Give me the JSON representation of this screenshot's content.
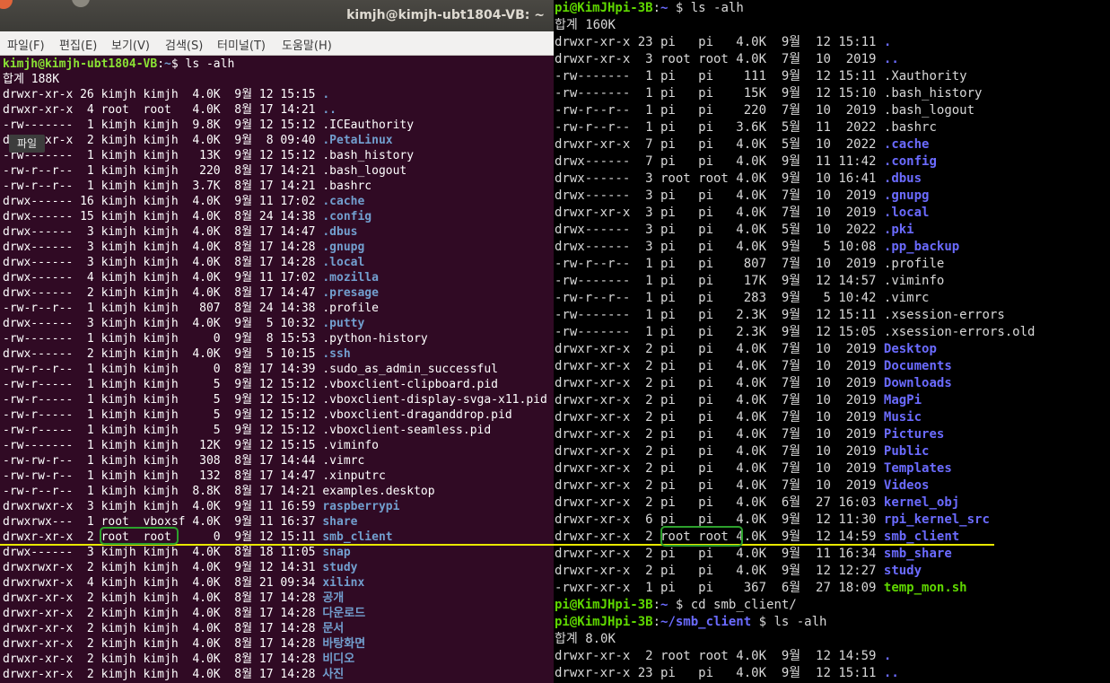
{
  "left_window": {
    "title": "kimjh@kimjh-ubt1804-VB: ~",
    "menu": [
      "파일(F)",
      "편집(E)",
      "보기(V)",
      "검색(S)",
      "터미널(T)",
      "도움말(H)"
    ],
    "tooltip": "파일",
    "prompt": {
      "user_host": "kimjh@kimjh-ubt1804-VB",
      "sep": ":",
      "path": "~",
      "symbol": "$ ",
      "command": "ls -alh"
    },
    "total": "합계 188K",
    "lines": [
      {
        "meta": "drwxr-xr-x 26 kimjh kimjh  4.0K  9월 12 15:15 ",
        "name": ".",
        "type": "dir"
      },
      {
        "meta": "drwxr-xr-x  4 root  root   4.0K  8월 17 14:21 ",
        "name": "..",
        "type": "dir"
      },
      {
        "meta": "-rw-------  1 kimjh kimjh  9.8K  9월 12 15:12 ",
        "name": ".ICEauthority",
        "type": "file"
      },
      {
        "meta": "drwxr-xr-x  2 kimjh kimjh  4.0K  9월  8 09:40 ",
        "name": ".PetaLinux",
        "type": "dir"
      },
      {
        "meta": "-rw-------  1 kimjh kimjh   13K  9월 12 15:12 ",
        "name": ".bash_history",
        "type": "file"
      },
      {
        "meta": "-rw-r--r--  1 kimjh kimjh   220  8월 17 14:21 ",
        "name": ".bash_logout",
        "type": "file"
      },
      {
        "meta": "-rw-r--r--  1 kimjh kimjh  3.7K  8월 17 14:21 ",
        "name": ".bashrc",
        "type": "file"
      },
      {
        "meta": "drwx------ 16 kimjh kimjh  4.0K  9월 11 17:02 ",
        "name": ".cache",
        "type": "dir"
      },
      {
        "meta": "drwx------ 15 kimjh kimjh  4.0K  8월 24 14:38 ",
        "name": ".config",
        "type": "dir"
      },
      {
        "meta": "drwx------  3 kimjh kimjh  4.0K  8월 17 14:47 ",
        "name": ".dbus",
        "type": "dir"
      },
      {
        "meta": "drwx------  3 kimjh kimjh  4.0K  8월 17 14:28 ",
        "name": ".gnupg",
        "type": "dir"
      },
      {
        "meta": "drwx------  3 kimjh kimjh  4.0K  8월 17 14:28 ",
        "name": ".local",
        "type": "dir"
      },
      {
        "meta": "drwx------  4 kimjh kimjh  4.0K  9월 11 17:02 ",
        "name": ".mozilla",
        "type": "dir"
      },
      {
        "meta": "drwx------  2 kimjh kimjh  4.0K  8월 17 14:47 ",
        "name": ".presage",
        "type": "dir"
      },
      {
        "meta": "-rw-r--r--  1 kimjh kimjh   807  8월 24 14:38 ",
        "name": ".profile",
        "type": "file"
      },
      {
        "meta": "drwx------  3 kimjh kimjh  4.0K  9월  5 10:32 ",
        "name": ".putty",
        "type": "dir"
      },
      {
        "meta": "-rw-------  1 kimjh kimjh     0  9월  8 15:53 ",
        "name": ".python-history",
        "type": "file"
      },
      {
        "meta": "drwx------  2 kimjh kimjh  4.0K  9월  5 10:15 ",
        "name": ".ssh",
        "type": "dir"
      },
      {
        "meta": "-rw-r--r--  1 kimjh kimjh     0  8월 17 14:39 ",
        "name": ".sudo_as_admin_successful",
        "type": "file"
      },
      {
        "meta": "-rw-r-----  1 kimjh kimjh     5  9월 12 15:12 ",
        "name": ".vboxclient-clipboard.pid",
        "type": "file"
      },
      {
        "meta": "-rw-r-----  1 kimjh kimjh     5  9월 12 15:12 ",
        "name": ".vboxclient-display-svga-x11.pid",
        "type": "file"
      },
      {
        "meta": "-rw-r-----  1 kimjh kimjh     5  9월 12 15:12 ",
        "name": ".vboxclient-draganddrop.pid",
        "type": "file"
      },
      {
        "meta": "-rw-r-----  1 kimjh kimjh     5  9월 12 15:12 ",
        "name": ".vboxclient-seamless.pid",
        "type": "file"
      },
      {
        "meta": "-rw-------  1 kimjh kimjh   12K  9월 12 15:15 ",
        "name": ".viminfo",
        "type": "file"
      },
      {
        "meta": "-rw-rw-r--  1 kimjh kimjh   308  8월 17 14:44 ",
        "name": ".vimrc",
        "type": "file"
      },
      {
        "meta": "-rw-rw-r--  1 kimjh kimjh   132  8월 17 14:47 ",
        "name": ".xinputrc",
        "type": "file"
      },
      {
        "meta": "-rw-r--r--  1 kimjh kimjh  8.8K  8월 17 14:21 ",
        "name": "examples.desktop",
        "type": "file"
      },
      {
        "meta": "drwxrwxr-x  3 kimjh kimjh  4.0K  9월 11 16:59 ",
        "name": "raspberrypi",
        "type": "dir"
      },
      {
        "meta": "drwxrwx---  1 root  vboxsf 4.0K  9월 11 16:37 ",
        "name": "share",
        "type": "dir"
      },
      {
        "meta": "drwxr-xr-x  2 root  root      0  9월 12 15:11 ",
        "name": "smb_client",
        "type": "dir"
      },
      {
        "meta": "drwx------  3 kimjh kimjh  4.0K  8월 18 11:05 ",
        "name": "snap",
        "type": "dir"
      },
      {
        "meta": "drwxrwxr-x  2 kimjh kimjh  4.0K  9월 12 14:31 ",
        "name": "study",
        "type": "dir"
      },
      {
        "meta": "drwxrwxr-x  4 kimjh kimjh  4.0K  8월 21 09:34 ",
        "name": "xilinx",
        "type": "dir"
      },
      {
        "meta": "drwxr-xr-x  2 kimjh kimjh  4.0K  8월 17 14:28 ",
        "name": "공개",
        "type": "dir"
      },
      {
        "meta": "drwxr-xr-x  2 kimjh kimjh  4.0K  8월 17 14:28 ",
        "name": "다운로드",
        "type": "dir"
      },
      {
        "meta": "drwxr-xr-x  2 kimjh kimjh  4.0K  8월 17 14:28 ",
        "name": "문서",
        "type": "dir"
      },
      {
        "meta": "drwxr-xr-x  2 kimjh kimjh  4.0K  8월 17 14:28 ",
        "name": "바탕화면",
        "type": "dir"
      },
      {
        "meta": "drwxr-xr-x  2 kimjh kimjh  4.0K  8월 17 14:28 ",
        "name": "비디오",
        "type": "dir"
      },
      {
        "meta": "drwxr-xr-x  2 kimjh kimjh  4.0K  8월 17 14:28 ",
        "name": "사진",
        "type": "dir"
      }
    ]
  },
  "right_window": {
    "prompt1": {
      "user_host": "pi@KimJHpi-3B",
      "sep": ":",
      "path": "~",
      "symbol": " $ ",
      "command": "ls -alh"
    },
    "total1": "합계 160K",
    "lines1": [
      {
        "meta": "drwxr-xr-x 23 pi   pi   4.0K  9월  12 15:11 ",
        "name": ".",
        "type": "dir"
      },
      {
        "meta": "drwxr-xr-x  3 root root 4.0K  7월  10  2019 ",
        "name": "..",
        "type": "dir"
      },
      {
        "meta": "-rw-------  1 pi   pi    111  9월  12 15:11 ",
        "name": ".Xauthority",
        "type": "file"
      },
      {
        "meta": "-rw-------  1 pi   pi    15K  9월  12 15:10 ",
        "name": ".bash_history",
        "type": "file"
      },
      {
        "meta": "-rw-r--r--  1 pi   pi    220  7월  10  2019 ",
        "name": ".bash_logout",
        "type": "file"
      },
      {
        "meta": "-rw-r--r--  1 pi   pi   3.6K  5월  11  2022 ",
        "name": ".bashrc",
        "type": "file"
      },
      {
        "meta": "drwxr-xr-x  7 pi   pi   4.0K  5월  10  2022 ",
        "name": ".cache",
        "type": "dir"
      },
      {
        "meta": "drwx------  7 pi   pi   4.0K  9월  11 11:42 ",
        "name": ".config",
        "type": "dir"
      },
      {
        "meta": "drwx------  3 root root 4.0K  9월  10 16:41 ",
        "name": ".dbus",
        "type": "dir"
      },
      {
        "meta": "drwx------  3 pi   pi   4.0K  7월  10  2019 ",
        "name": ".gnupg",
        "type": "dir"
      },
      {
        "meta": "drwxr-xr-x  3 pi   pi   4.0K  7월  10  2019 ",
        "name": ".local",
        "type": "dir"
      },
      {
        "meta": "drwx------  3 pi   pi   4.0K  5월  10  2022 ",
        "name": ".pki",
        "type": "dir"
      },
      {
        "meta": "drwx------  3 pi   pi   4.0K  9월   5 10:08 ",
        "name": ".pp_backup",
        "type": "dir"
      },
      {
        "meta": "-rw-r--r--  1 pi   pi    807  7월  10  2019 ",
        "name": ".profile",
        "type": "file"
      },
      {
        "meta": "-rw-------  1 pi   pi    17K  9월  12 14:57 ",
        "name": ".viminfo",
        "type": "file"
      },
      {
        "meta": "-rw-r--r--  1 pi   pi    283  9월   5 10:42 ",
        "name": ".vimrc",
        "type": "file"
      },
      {
        "meta": "-rw-------  1 pi   pi   2.3K  9월  12 15:11 ",
        "name": ".xsession-errors",
        "type": "file"
      },
      {
        "meta": "-rw-------  1 pi   pi   2.3K  9월  12 15:05 ",
        "name": ".xsession-errors.old",
        "type": "file"
      },
      {
        "meta": "drwxr-xr-x  2 pi   pi   4.0K  7월  10  2019 ",
        "name": "Desktop",
        "type": "dir"
      },
      {
        "meta": "drwxr-xr-x  2 pi   pi   4.0K  7월  10  2019 ",
        "name": "Documents",
        "type": "dir"
      },
      {
        "meta": "drwxr-xr-x  2 pi   pi   4.0K  7월  10  2019 ",
        "name": "Downloads",
        "type": "dir"
      },
      {
        "meta": "drwxr-xr-x  2 pi   pi   4.0K  7월  10  2019 ",
        "name": "MagPi",
        "type": "dir"
      },
      {
        "meta": "drwxr-xr-x  2 pi   pi   4.0K  7월  10  2019 ",
        "name": "Music",
        "type": "dir"
      },
      {
        "meta": "drwxr-xr-x  2 pi   pi   4.0K  7월  10  2019 ",
        "name": "Pictures",
        "type": "dir"
      },
      {
        "meta": "drwxr-xr-x  2 pi   pi   4.0K  7월  10  2019 ",
        "name": "Public",
        "type": "dir"
      },
      {
        "meta": "drwxr-xr-x  2 pi   pi   4.0K  7월  10  2019 ",
        "name": "Templates",
        "type": "dir"
      },
      {
        "meta": "drwxr-xr-x  2 pi   pi   4.0K  7월  10  2019 ",
        "name": "Videos",
        "type": "dir"
      },
      {
        "meta": "drwxr-xr-x  2 pi   pi   4.0K  6월  27 16:03 ",
        "name": "kernel_obj",
        "type": "dir"
      },
      {
        "meta": "drwxr-xr-x  6 pi   pi   4.0K  9월  12 11:30 ",
        "name": "rpi_kernel_src",
        "type": "dir"
      },
      {
        "meta": "drwxr-xr-x  2 root root 4.0K  9월  12 14:59 ",
        "name": "smb_client",
        "type": "dir"
      },
      {
        "meta": "drwxr-xr-x  2 pi   pi   4.0K  9월  11 16:34 ",
        "name": "smb_share",
        "type": "dir"
      },
      {
        "meta": "drwxr-xr-x  2 pi   pi   4.0K  9월  12 12:27 ",
        "name": "study",
        "type": "dir"
      },
      {
        "meta": "-rwxr-xr-x  1 pi   pi    367  6월  27 18:09 ",
        "name": "temp_mon.sh",
        "type": "exec"
      }
    ],
    "prompt2": {
      "user_host": "pi@KimJHpi-3B",
      "sep": ":",
      "path": "~",
      "symbol": " $ ",
      "command": "cd smb_client/"
    },
    "prompt3": {
      "user_host": "pi@KimJHpi-3B",
      "sep": ":",
      "path": "~/smb_client",
      "symbol": " $ ",
      "command": "ls -alh"
    },
    "total2": "합계 8.0K",
    "lines2": [
      {
        "meta": "drwxr-xr-x  2 root root 4.0K  9월  12 14:59 ",
        "name": ".",
        "type": "dir"
      },
      {
        "meta": "drwxr-xr-x 23 pi   pi   4.0K  9월  12 15:11 ",
        "name": "..",
        "type": "dir"
      }
    ]
  },
  "colors": {
    "left_bg": "#300a24",
    "right_bg": "#000000",
    "annotation_line": "#e8e800",
    "annotation_box": "#2ca02c"
  }
}
